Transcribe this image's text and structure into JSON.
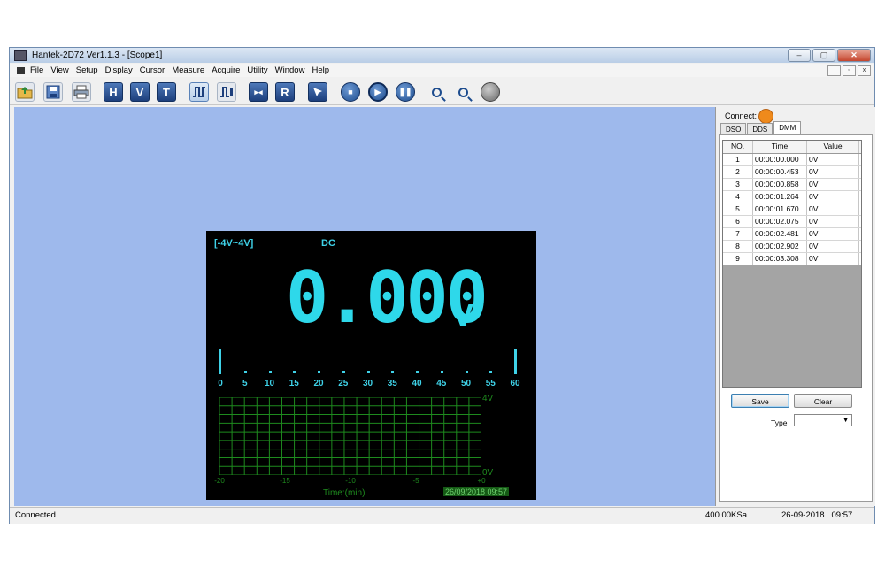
{
  "window": {
    "title": "Hantek-2D72 Ver1.1.3 - [Scope1]",
    "minimize": "‒",
    "maximize": "▢",
    "close": "✕"
  },
  "menu": {
    "items": [
      "File",
      "View",
      "Setup",
      "Display",
      "Cursor",
      "Measure",
      "Acquire",
      "Utility",
      "Window",
      "Help"
    ]
  },
  "toolbar": {
    "h_label": "H",
    "v_label": "V",
    "t_label": "T",
    "r_label": "R",
    "icons": [
      "open-folder-icon",
      "save-disk-icon",
      "print-icon",
      "horizontal-icon",
      "vertical-icon",
      "trigger-icon",
      "pulse-icon",
      "pulse-stack-icon",
      "auto-set-icon",
      "reference-icon",
      "cursor-icon",
      "stop-icon",
      "run-icon",
      "pause-icon",
      "zoom-in-icon",
      "zoom-out-icon",
      "clear-icon"
    ]
  },
  "dmm": {
    "range": "[-4V~4V]",
    "mode": "DC",
    "value": "0.000",
    "unit": "V",
    "scale": [
      "0",
      "5",
      "10",
      "15",
      "20",
      "25",
      "30",
      "35",
      "40",
      "45",
      "50",
      "55",
      "60"
    ],
    "trend_y_top": "4V",
    "trend_y_bottom": "0V",
    "trend_x": [
      "-20",
      "-15",
      "-10",
      "-5",
      "+0"
    ],
    "time_label": "Time:(min)",
    "timestamp": "26/09/2018 09:57",
    "display_color": "#2ed8ea",
    "grid_color": "#1e8a1e"
  },
  "panel": {
    "connect_label": "Connect:",
    "connect_color": "#ef8a1c",
    "tabs": [
      "DSO",
      "DDS",
      "DMM"
    ],
    "active_tab": "DMM",
    "table": {
      "headers": [
        "NO.",
        "Time",
        "Value"
      ],
      "rows": [
        [
          "1",
          "00:00:00.000",
          "0V"
        ],
        [
          "2",
          "00:00:00.453",
          "0V"
        ],
        [
          "3",
          "00:00:00.858",
          "0V"
        ],
        [
          "4",
          "00:00:01.264",
          "0V"
        ],
        [
          "5",
          "00:00:01.670",
          "0V"
        ],
        [
          "6",
          "00:00:02.075",
          "0V"
        ],
        [
          "7",
          "00:00:02.481",
          "0V"
        ],
        [
          "8",
          "00:00:02.902",
          "0V"
        ],
        [
          "9",
          "00:00:03.308",
          "0V"
        ]
      ]
    },
    "save_label": "Save",
    "clear_label": "Clear",
    "type_label": "Type",
    "type_value": ""
  },
  "status": {
    "left": "Connected",
    "rate": "400.00KSa",
    "datetime": "26-09-2018   09:57"
  },
  "colors": {
    "canvas": "#9eb9ec",
    "toolbar_blue": "#1d3f7c"
  }
}
